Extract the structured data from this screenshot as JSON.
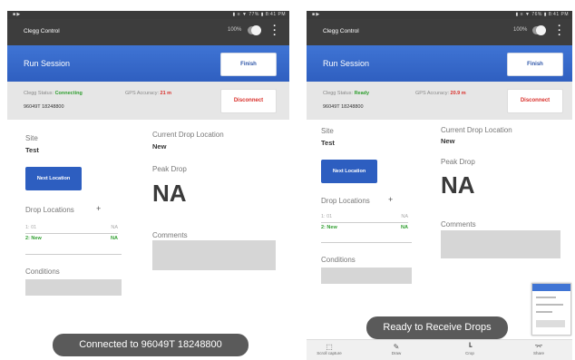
{
  "left": {
    "statusbar": {
      "left_icons": "■ ▶",
      "right_text": "▮ ≡ ▼ 77% ▮ 8:41 PM"
    },
    "appbar": {
      "title": "Clegg Control",
      "percent": "100%"
    },
    "session": {
      "title": "Run Session",
      "finish_label": "Finish"
    },
    "status": {
      "clegg_label": "Clegg Status:",
      "clegg_value": "Connecting",
      "gps_label": "GPS Accuracy:",
      "gps_value": "21 m",
      "serial": "96049T 18248800",
      "disconnect_label": "Disconnect"
    },
    "site": {
      "label": "Site",
      "value": "Test"
    },
    "current_drop": {
      "label": "Current Drop Location",
      "value": "New"
    },
    "next_location_label": "Next Location",
    "peak_drop": {
      "label": "Peak Drop",
      "value": "NA"
    },
    "drop_locations": {
      "label": "Drop Locations",
      "add": "+",
      "rows": [
        {
          "name": "1: 01",
          "value": "NA"
        },
        {
          "name": "2: New",
          "value": "NA"
        }
      ]
    },
    "comments_label": "Comments",
    "conditions_label": "Conditions",
    "toast": "Connected to 96049T 18248800"
  },
  "right": {
    "statusbar": {
      "left_icons": "■ ▶",
      "right_text": "▮ ≡ ▼ 76% ▮ 8:41 PM"
    },
    "appbar": {
      "title": "Clegg Control",
      "percent": "100%"
    },
    "session": {
      "title": "Run Session",
      "finish_label": "Finish"
    },
    "status": {
      "clegg_label": "Clegg Status:",
      "clegg_value": "Ready",
      "gps_label": "GPS Accuracy:",
      "gps_value": "20.9 m",
      "serial": "96049T 18248800",
      "disconnect_label": "Disconnect"
    },
    "site": {
      "label": "Site",
      "value": "Test"
    },
    "current_drop": {
      "label": "Current Drop Location",
      "value": "New"
    },
    "next_location_label": "Next Location",
    "peak_drop": {
      "label": "Peak Drop",
      "value": "NA"
    },
    "drop_locations": {
      "label": "Drop Locations",
      "add": "+",
      "rows": [
        {
          "name": "1: 01",
          "value": "NA"
        },
        {
          "name": "2: New",
          "value": "NA"
        }
      ]
    },
    "comments_label": "Comments",
    "conditions_label": "Conditions",
    "toast": "Ready to Receive Drops",
    "navbar": [
      {
        "icon": "scroll-capture-icon",
        "glyph": "⬚",
        "label": "Scroll capture"
      },
      {
        "icon": "draw-icon",
        "glyph": "✎",
        "label": "Draw"
      },
      {
        "icon": "crop-icon",
        "glyph": "┗",
        "label": "Crop"
      },
      {
        "icon": "share-icon",
        "glyph": "⌤",
        "label": "Share"
      }
    ]
  }
}
